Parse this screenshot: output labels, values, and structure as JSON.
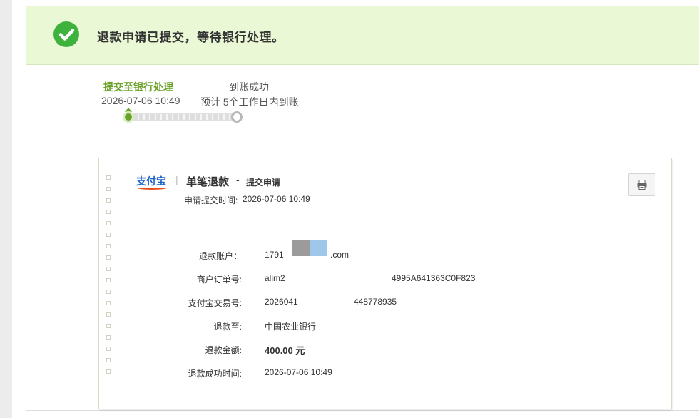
{
  "banner": {
    "message": "退款申请已提交，等待银行处理。",
    "icon": "check-circle-icon"
  },
  "progress": {
    "steps": [
      {
        "title": "提交至银行处理",
        "subtitle": "2026-07-06 10:49",
        "status": "done"
      },
      {
        "title": "到账成功",
        "subtitle": "预计 5个工作日内到账",
        "status": "pending"
      }
    ]
  },
  "receipt": {
    "logo_text": "支付宝",
    "separator": "|",
    "title": "单笔退款",
    "dash": "-",
    "subtitle": "提交申请",
    "submit_time_label": "申请提交时间:",
    "submit_time_value": "2026-07-06 10:49",
    "print_icon": "printer-icon",
    "rows": [
      {
        "label": "退款账户：",
        "value_start": "1791",
        "value_end": ".com"
      },
      {
        "label": "商户订单号:",
        "value_start": "alim2",
        "value_end": "4995A641363C0F823"
      },
      {
        "label": "支付宝交易号:",
        "value_start": "2026041",
        "value_end": "448778935"
      },
      {
        "label": "退款至:",
        "value": "中国农业银行"
      },
      {
        "label": "退款金额:",
        "value": "400.00 元"
      },
      {
        "label": "退款成功时间:",
        "value": "2026-07-06 10:49"
      }
    ]
  },
  "colors": {
    "success_green": "#3fb23d",
    "step_green": "#6aa128",
    "banner_bg": "#eaf8d6"
  }
}
